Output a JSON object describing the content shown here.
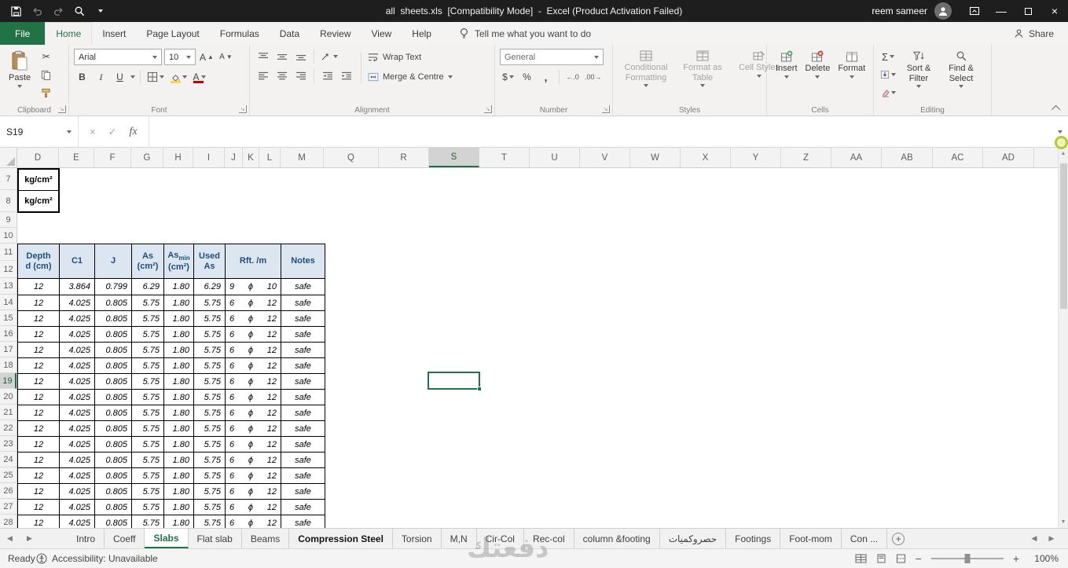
{
  "colors": {
    "excel_green": "#217346",
    "table_header_text": "#1f4e79",
    "table_header_fill": "#dce6f1",
    "titlebar": "#1e1e1e"
  },
  "title_bar": {
    "title": "all  sheets.xls  [Compatibility Mode]  -  Excel (Product Activation Failed)",
    "user": "reem sameer"
  },
  "ribbon": {
    "tabs": [
      {
        "label": "File",
        "file": true
      },
      {
        "label": "Home",
        "active": true
      },
      {
        "label": "Insert"
      },
      {
        "label": "Page Layout"
      },
      {
        "label": "Formulas"
      },
      {
        "label": "Data"
      },
      {
        "label": "Review"
      },
      {
        "label": "View"
      },
      {
        "label": "Help"
      }
    ],
    "tell_me": "Tell me what you want to do",
    "share": "Share",
    "clipboard": {
      "label": "Clipboard",
      "paste": "Paste"
    },
    "font": {
      "label": "Font",
      "family": "Arial",
      "size": "10",
      "bold": "B",
      "italic": "I",
      "underline": "U",
      "grow_font": "A",
      "shrink_font": "A",
      "font_color": "A"
    },
    "alignment": {
      "label": "Alignment",
      "wrap_text": "Wrap Text",
      "merge_centre": "Merge & Centre"
    },
    "number": {
      "label": "Number",
      "format": "General",
      "currency": "$",
      "percent": "%",
      "comma": ","
    },
    "styles": {
      "label": "Styles",
      "conditional": "Conditional Formatting",
      "format_table": "Format as Table",
      "cell_styles": "Cell Styles"
    },
    "cells": {
      "label": "Cells",
      "insert": "Insert",
      "delete": "Delete",
      "format": "Format"
    },
    "editing": {
      "label": "Editing",
      "autosum": "Σ",
      "sort_filter": "Sort & Filter",
      "find_select": "Find & Select"
    }
  },
  "formula_bar": {
    "name_box": "S19",
    "fx": "fx"
  },
  "grid": {
    "columns": [
      "D",
      "E",
      "F",
      "G",
      "H",
      "I",
      "J",
      "K",
      "L",
      "M",
      "Q",
      "R",
      "S",
      "T",
      "U",
      "V",
      "W",
      "X",
      "Y",
      "Z",
      "AA",
      "AB",
      "AC",
      "AD"
    ],
    "selected_column": "S",
    "rows": [
      7,
      8,
      9,
      10,
      11,
      12,
      13,
      14,
      15,
      16,
      17,
      18,
      19,
      20,
      21,
      22,
      23,
      24,
      25,
      26,
      27,
      28
    ],
    "selected_row": 19,
    "active_cell": "S19",
    "unit_cells": [
      "kg/cm²",
      "kg/cm²"
    ]
  },
  "table": {
    "header": {
      "depth_line1": "Depth",
      "depth_line2": "d (cm)",
      "c1": "C1",
      "j": "J",
      "as_line1": "As",
      "as_line2": "(cm²)",
      "asmin_main": "As",
      "asmin_sub": "min",
      "asmin_line2": "(cm²)",
      "used_line1": "Used",
      "used_line2": "As",
      "rft": "Rft. /m",
      "notes": "Notes"
    },
    "phi": "ϕ",
    "rows": [
      {
        "d": "12",
        "c1": "3.864",
        "j": "0.799",
        "as": "6.29",
        "asmin": "1.80",
        "used": "6.29",
        "n": "9",
        "dia": "10",
        "notes": "safe"
      },
      {
        "d": "12",
        "c1": "4.025",
        "j": "0.805",
        "as": "5.75",
        "asmin": "1.80",
        "used": "5.75",
        "n": "6",
        "dia": "12",
        "notes": "safe"
      },
      {
        "d": "12",
        "c1": "4.025",
        "j": "0.805",
        "as": "5.75",
        "asmin": "1.80",
        "used": "5.75",
        "n": "6",
        "dia": "12",
        "notes": "safe"
      },
      {
        "d": "12",
        "c1": "4.025",
        "j": "0.805",
        "as": "5.75",
        "asmin": "1.80",
        "used": "5.75",
        "n": "6",
        "dia": "12",
        "notes": "safe"
      },
      {
        "d": "12",
        "c1": "4.025",
        "j": "0.805",
        "as": "5.75",
        "asmin": "1.80",
        "used": "5.75",
        "n": "6",
        "dia": "12",
        "notes": "safe"
      },
      {
        "d": "12",
        "c1": "4.025",
        "j": "0.805",
        "as": "5.75",
        "asmin": "1.80",
        "used": "5.75",
        "n": "6",
        "dia": "12",
        "notes": "safe"
      },
      {
        "d": "12",
        "c1": "4.025",
        "j": "0.805",
        "as": "5.75",
        "asmin": "1.80",
        "used": "5.75",
        "n": "6",
        "dia": "12",
        "notes": "safe"
      },
      {
        "d": "12",
        "c1": "4.025",
        "j": "0.805",
        "as": "5.75",
        "asmin": "1.80",
        "used": "5.75",
        "n": "6",
        "dia": "12",
        "notes": "safe"
      },
      {
        "d": "12",
        "c1": "4.025",
        "j": "0.805",
        "as": "5.75",
        "asmin": "1.80",
        "used": "5.75",
        "n": "6",
        "dia": "12",
        "notes": "safe"
      },
      {
        "d": "12",
        "c1": "4.025",
        "j": "0.805",
        "as": "5.75",
        "asmin": "1.80",
        "used": "5.75",
        "n": "6",
        "dia": "12",
        "notes": "safe"
      },
      {
        "d": "12",
        "c1": "4.025",
        "j": "0.805",
        "as": "5.75",
        "asmin": "1.80",
        "used": "5.75",
        "n": "6",
        "dia": "12",
        "notes": "safe"
      },
      {
        "d": "12",
        "c1": "4.025",
        "j": "0.805",
        "as": "5.75",
        "asmin": "1.80",
        "used": "5.75",
        "n": "6",
        "dia": "12",
        "notes": "safe"
      },
      {
        "d": "12",
        "c1": "4.025",
        "j": "0.805",
        "as": "5.75",
        "asmin": "1.80",
        "used": "5.75",
        "n": "6",
        "dia": "12",
        "notes": "safe"
      },
      {
        "d": "12",
        "c1": "4.025",
        "j": "0.805",
        "as": "5.75",
        "asmin": "1.80",
        "used": "5.75",
        "n": "6",
        "dia": "12",
        "notes": "safe"
      },
      {
        "d": "12",
        "c1": "4.025",
        "j": "0.805",
        "as": "5.75",
        "asmin": "1.80",
        "used": "5.75",
        "n": "6",
        "dia": "12",
        "notes": "safe"
      },
      {
        "d": "12",
        "c1": "4.025",
        "j": "0.805",
        "as": "5.75",
        "asmin": "1.80",
        "used": "5.75",
        "n": "6",
        "dia": "12",
        "notes": "safe"
      }
    ]
  },
  "sheet_tabs": [
    {
      "label": "Intro"
    },
    {
      "label": "Coeff"
    },
    {
      "label": "Slabs",
      "active": true
    },
    {
      "label": "Flat slab"
    },
    {
      "label": "Beams"
    },
    {
      "label": "Compression Steel",
      "bold": true
    },
    {
      "label": "Torsion"
    },
    {
      "label": "M,N"
    },
    {
      "label": "Cir-Col"
    },
    {
      "label": "Rec-col"
    },
    {
      "label": "column &footing"
    },
    {
      "label": "حصروكميات"
    },
    {
      "label": "Footings"
    },
    {
      "label": "Foot-mom"
    },
    {
      "label": "Con ..."
    }
  ],
  "tab_bar": {
    "new_sheet": "+"
  },
  "status_bar": {
    "ready": "Ready",
    "accessibility": "Accessibility: Unavailable",
    "zoom": "100%"
  },
  "watermark": "دفعتك"
}
